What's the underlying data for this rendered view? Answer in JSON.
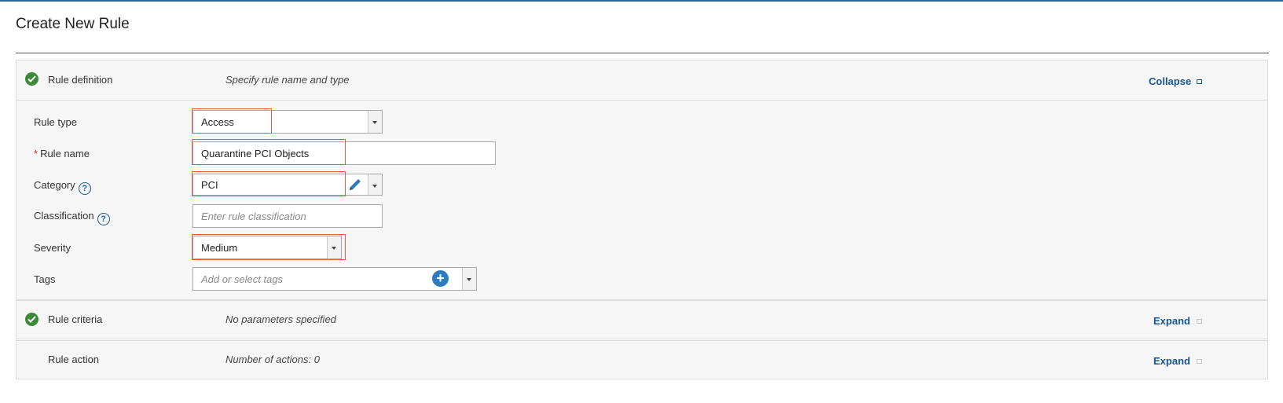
{
  "page": {
    "title": "Create New Rule"
  },
  "sections": {
    "definition": {
      "label": "Rule definition",
      "description": "Specify rule name and type",
      "toggle": "Collapse"
    },
    "criteria": {
      "label": "Rule criteria",
      "description": "No parameters specified",
      "toggle": "Expand"
    },
    "action": {
      "label": "Rule action",
      "description": "Number of actions: 0",
      "toggle": "Expand"
    }
  },
  "form": {
    "rule_type": {
      "label": "Rule type",
      "value": "Access"
    },
    "rule_name": {
      "required_mark": "*",
      "label": "Rule name",
      "value": "Quarantine PCI Objects"
    },
    "category": {
      "label": "Category",
      "help": "?",
      "value": "PCI"
    },
    "classification": {
      "label": "Classification",
      "help": "?",
      "placeholder": "Enter rule classification"
    },
    "severity": {
      "label": "Severity",
      "value": "Medium"
    },
    "tags": {
      "label": "Tags",
      "placeholder": "Add or select tags",
      "add": "+"
    }
  },
  "colors": {
    "accent": "#16578f",
    "highlight": "#e0613f",
    "success": "#3a8a3a",
    "add_button": "#2c7dc0"
  },
  "icons": [
    "check-circle-icon",
    "help-icon",
    "pencil-icon",
    "plus-icon",
    "chevron-down-icon",
    "collapse-square-icon",
    "expand-square-icon"
  ]
}
